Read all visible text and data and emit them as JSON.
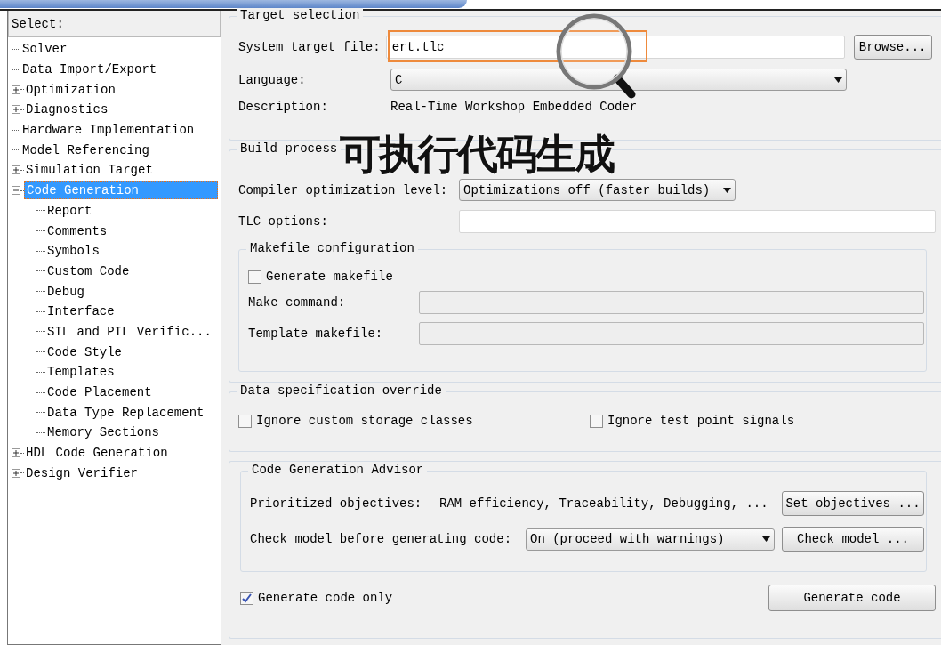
{
  "tree": {
    "header": "Select:",
    "items": [
      {
        "label": "Solver",
        "kind": "leaf",
        "selected": false
      },
      {
        "label": "Data Import/Export",
        "kind": "leaf",
        "selected": false
      },
      {
        "label": "Optimization",
        "kind": "branch",
        "expanded": false,
        "selected": false
      },
      {
        "label": "Diagnostics",
        "kind": "branch",
        "expanded": false,
        "selected": false
      },
      {
        "label": "Hardware Implementation",
        "kind": "leaf",
        "selected": false
      },
      {
        "label": "Model Referencing",
        "kind": "leaf",
        "selected": false
      },
      {
        "label": "Simulation Target",
        "kind": "branch",
        "expanded": false,
        "selected": false
      },
      {
        "label": "Code Generation",
        "kind": "branch",
        "expanded": true,
        "selected": true,
        "children": [
          {
            "label": "Report",
            "kind": "leaf",
            "selected": false
          },
          {
            "label": "Comments",
            "kind": "leaf",
            "selected": false
          },
          {
            "label": "Symbols",
            "kind": "leaf",
            "selected": false
          },
          {
            "label": "Custom Code",
            "kind": "leaf",
            "selected": false
          },
          {
            "label": "Debug",
            "kind": "leaf",
            "selected": false
          },
          {
            "label": "Interface",
            "kind": "leaf",
            "selected": false
          },
          {
            "label": "SIL and PIL Verific...",
            "kind": "leaf",
            "selected": false
          },
          {
            "label": "Code Style",
            "kind": "leaf",
            "selected": false
          },
          {
            "label": "Templates",
            "kind": "leaf",
            "selected": false
          },
          {
            "label": "Code Placement",
            "kind": "leaf",
            "selected": false
          },
          {
            "label": "Data Type Replacement",
            "kind": "leaf",
            "selected": false
          },
          {
            "label": "Memory Sections",
            "kind": "leaf",
            "selected": false
          }
        ]
      },
      {
        "label": "HDL Code Generation",
        "kind": "branch",
        "expanded": false,
        "selected": false
      },
      {
        "label": "Design Verifier",
        "kind": "branch",
        "expanded": false,
        "selected": false
      }
    ]
  },
  "target_selection": {
    "title": "Target selection",
    "system_target_file": {
      "label": "System target file:",
      "value": "ert.tlc",
      "highlighted": true
    },
    "browse_button": "Browse...",
    "language": {
      "label": "Language:",
      "value": "C"
    },
    "description": {
      "label": "Description:",
      "value": "Real-Time Workshop Embedded Coder"
    }
  },
  "build_process": {
    "title": "Build process",
    "compiler_optimization": {
      "label": "Compiler optimization level:",
      "value": "Optimizations off (faster builds)"
    },
    "tlc_options": {
      "label": "TLC options:"
    },
    "makefile_configuration": {
      "title": "Makefile configuration",
      "generate_makefile": {
        "label": "Generate makefile",
        "checked": false
      },
      "make_command": {
        "label": "Make command:",
        "disabled": true
      },
      "template_makefile": {
        "label": "Template makefile:",
        "disabled": true
      }
    }
  },
  "data_specification_override": {
    "title": "Data specification override",
    "checkboxes": [
      {
        "label": "Ignore custom storage classes",
        "checked": false
      },
      {
        "label": "Ignore test point signals",
        "checked": false
      }
    ]
  },
  "code_generation_advisor": {
    "title": "Code Generation Advisor",
    "prioritized_objectives": {
      "label": "Prioritized objectives:",
      "value": "RAM efficiency, Traceability, Debugging, ..."
    },
    "set_objectives_button": "Set objectives ...",
    "check_model": {
      "label": "Check model before generating code:",
      "value": "On (proceed with warnings)"
    },
    "check_model_button": "Check model ..."
  },
  "generate_code_only": {
    "label": "Generate code only",
    "checked": true
  },
  "generate_code_button": "Generate code",
  "overlay": {
    "caption": "可执行代码生成"
  }
}
